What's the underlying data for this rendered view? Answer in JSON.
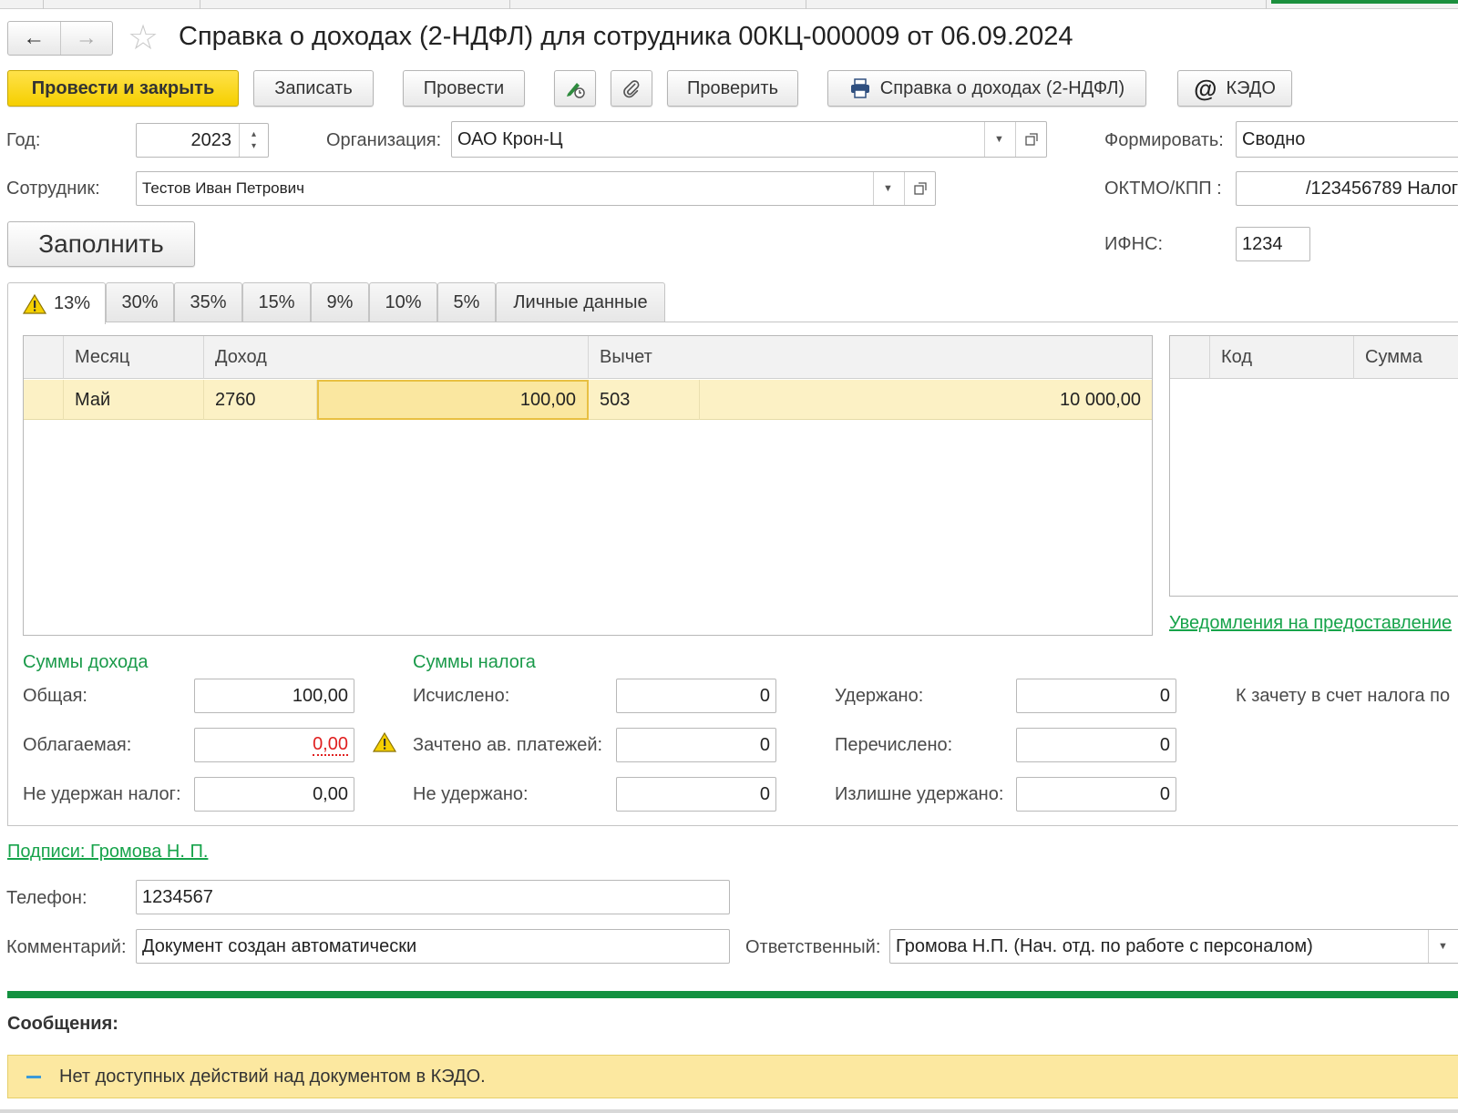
{
  "window": {
    "title": "Справка о доходах (2-НДФЛ) для сотрудника 00КЦ-000009 от 06.09.2024"
  },
  "toolbar": {
    "post_close": "Провести и закрыть",
    "save": "Записать",
    "post": "Провести",
    "check": "Проверить",
    "print_report": "Справка о доходах (2-НДФЛ)",
    "kedo": "КЭДО"
  },
  "header": {
    "year_label": "Год:",
    "year_value": "2023",
    "org_label": "Организация:",
    "org_value": "ОАО Крон-Ц",
    "form_label": "Формировать:",
    "form_value": "Сводно",
    "employee_label": "Сотрудник:",
    "employee_value": "Тестов Иван Петрович",
    "oktmo_label": "ОКТМО/КПП :",
    "oktmo_value": "/123456789 Налог",
    "fill_button": "Заполнить",
    "ifns_label": "ИФНС:",
    "ifns_value": "1234"
  },
  "tabs": [
    {
      "label": "13%",
      "warning": true
    },
    {
      "label": "30%"
    },
    {
      "label": "35%"
    },
    {
      "label": "15%"
    },
    {
      "label": "9%"
    },
    {
      "label": "10%"
    },
    {
      "label": "5%"
    },
    {
      "label": "Личные данные"
    }
  ],
  "income_table": {
    "headers": [
      "Месяц",
      "Доход",
      "Вычет"
    ],
    "rows": [
      {
        "month": "Май",
        "income_code": "2760",
        "income_amount": "100,00",
        "deduction_code": "503",
        "deduction_amount": "10 000,00"
      }
    ]
  },
  "side_table": {
    "headers": [
      "Код",
      "Сумма"
    ],
    "link": "Уведомления на предоставление"
  },
  "income_sums": {
    "title": "Суммы дохода",
    "total_label": "Общая:",
    "total_value": "100,00",
    "taxable_label": "Облагаемая:",
    "taxable_value": "0,00",
    "not_withheld_label": "Не удержан налог:",
    "not_withheld_value": "0,00"
  },
  "tax_sums": {
    "title": "Суммы налога",
    "calculated_label": "Исчислено:",
    "calculated_value": "0",
    "credited_label": "Зачтено ав. платежей:",
    "credited_value": "0",
    "not_withheld_label": "Не удержано:",
    "not_withheld_value": "0",
    "withheld_label": "Удержано:",
    "withheld_value": "0",
    "transferred_label": "Перечислено:",
    "transferred_value": "0",
    "over_withheld_label": "Излишне удержано:",
    "over_withheld_value": "0",
    "offset_label": "К зачету в счет налога по"
  },
  "footer": {
    "signatures_link": "Подписи: Громова Н. П.",
    "phone_label": "Телефон:",
    "phone_value": "1234567",
    "comment_label": "Комментарий:",
    "comment_value": "Документ создан автоматически",
    "responsible_label": "Ответственный:",
    "responsible_value": "Громова Н.П. (Нач. отд. по работе с персоналом)"
  },
  "messages": {
    "title": "Сообщения:",
    "items": [
      "Нет доступных действий над документом в КЭДО."
    ]
  },
  "colors": {
    "primary_button": "#f5cf00",
    "link_green": "#16a34a",
    "row_highlight": "#fcf1c5",
    "error_red": "#e02020",
    "message_bg": "#fce8a0"
  }
}
